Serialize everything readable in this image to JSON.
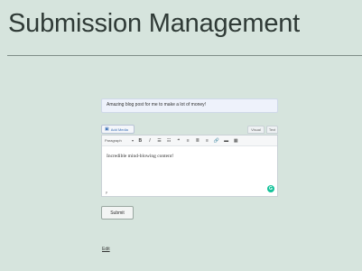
{
  "page": {
    "title": "Submission Management"
  },
  "form": {
    "title_value": "Amazing blog post for me to make a lot of money!",
    "add_media_label": "Add Media",
    "tabs": {
      "visual": "Visual",
      "text": "Text"
    },
    "toolbar": {
      "format": "Paragraph",
      "buttons": [
        {
          "name": "bold-button",
          "glyph": "B"
        },
        {
          "name": "italic-button",
          "glyph": "I"
        },
        {
          "name": "bulleted-list-button",
          "glyph": "☰"
        },
        {
          "name": "numbered-list-button",
          "glyph": "☷"
        },
        {
          "name": "blockquote-button",
          "glyph": "❝"
        },
        {
          "name": "align-left-button",
          "glyph": "≡"
        },
        {
          "name": "align-center-button",
          "glyph": "≣"
        },
        {
          "name": "align-right-button",
          "glyph": "≡"
        },
        {
          "name": "insert-link-button",
          "glyph": "🔗"
        },
        {
          "name": "read-more-button",
          "glyph": "▬"
        },
        {
          "name": "toolbar-toggle-button",
          "glyph": "▦"
        }
      ]
    },
    "content": "Incredible mind-blowing content!",
    "path": "p",
    "submit_label": "Submit"
  },
  "footer": {
    "edit_link": "Edit"
  },
  "colors": {
    "background": "#d6e4dd",
    "grammarly": "#15c39a",
    "accent": "#3a6fb5"
  }
}
